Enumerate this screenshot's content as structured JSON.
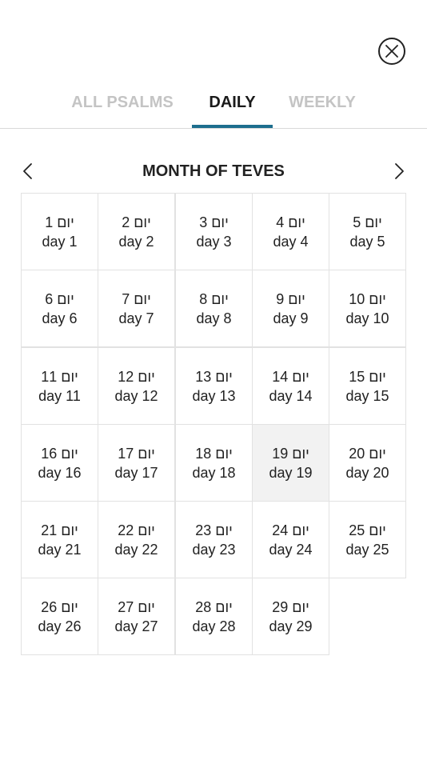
{
  "tabs": [
    {
      "label": "ALL PSALMS",
      "active": false
    },
    {
      "label": "DAILY",
      "active": true
    },
    {
      "label": "WEEKLY",
      "active": false
    }
  ],
  "calendar": {
    "month_title": "MONTH OF TEVES",
    "selected_day": 19,
    "days": [
      {
        "hebrew": "יום 1",
        "label": "day 1"
      },
      {
        "hebrew": "יום 2",
        "label": "day 2"
      },
      {
        "hebrew": "יום 3",
        "label": "day 3"
      },
      {
        "hebrew": "יום 4",
        "label": "day 4"
      },
      {
        "hebrew": "יום 5",
        "label": "day 5"
      },
      {
        "hebrew": "יום 6",
        "label": "day 6"
      },
      {
        "hebrew": "יום 7",
        "label": "day 7"
      },
      {
        "hebrew": "יום 8",
        "label": "day 8"
      },
      {
        "hebrew": "יום 9",
        "label": "day 9"
      },
      {
        "hebrew": "יום 10",
        "label": "day 10"
      },
      {
        "hebrew": "יום 11",
        "label": "day 11"
      },
      {
        "hebrew": "יום 12",
        "label": "day 12"
      },
      {
        "hebrew": "יום 13",
        "label": "day 13"
      },
      {
        "hebrew": "יום 14",
        "label": "day 14"
      },
      {
        "hebrew": "יום 15",
        "label": "day 15"
      },
      {
        "hebrew": "יום 16",
        "label": "day 16"
      },
      {
        "hebrew": "יום 17",
        "label": "day 17"
      },
      {
        "hebrew": "יום 18",
        "label": "day 18"
      },
      {
        "hebrew": "יום 19",
        "label": "day 19"
      },
      {
        "hebrew": "יום 20",
        "label": "day 20"
      },
      {
        "hebrew": "יום 21",
        "label": "day 21"
      },
      {
        "hebrew": "יום 22",
        "label": "day 22"
      },
      {
        "hebrew": "יום 23",
        "label": "day 23"
      },
      {
        "hebrew": "יום 24",
        "label": "day 24"
      },
      {
        "hebrew": "יום 25",
        "label": "day 25"
      },
      {
        "hebrew": "יום 26",
        "label": "day 26"
      },
      {
        "hebrew": "יום 27",
        "label": "day 27"
      },
      {
        "hebrew": "יום 28",
        "label": "day 28"
      },
      {
        "hebrew": "יום 29",
        "label": "day 29"
      }
    ]
  },
  "icons": {
    "close": "close-circle-icon",
    "prev": "chevron-left-icon",
    "next": "chevron-right-icon"
  },
  "colors": {
    "accent": "#1d6e8e",
    "selected_cell": "#f2f2f2",
    "inactive_tab": "#c4c4c4"
  }
}
